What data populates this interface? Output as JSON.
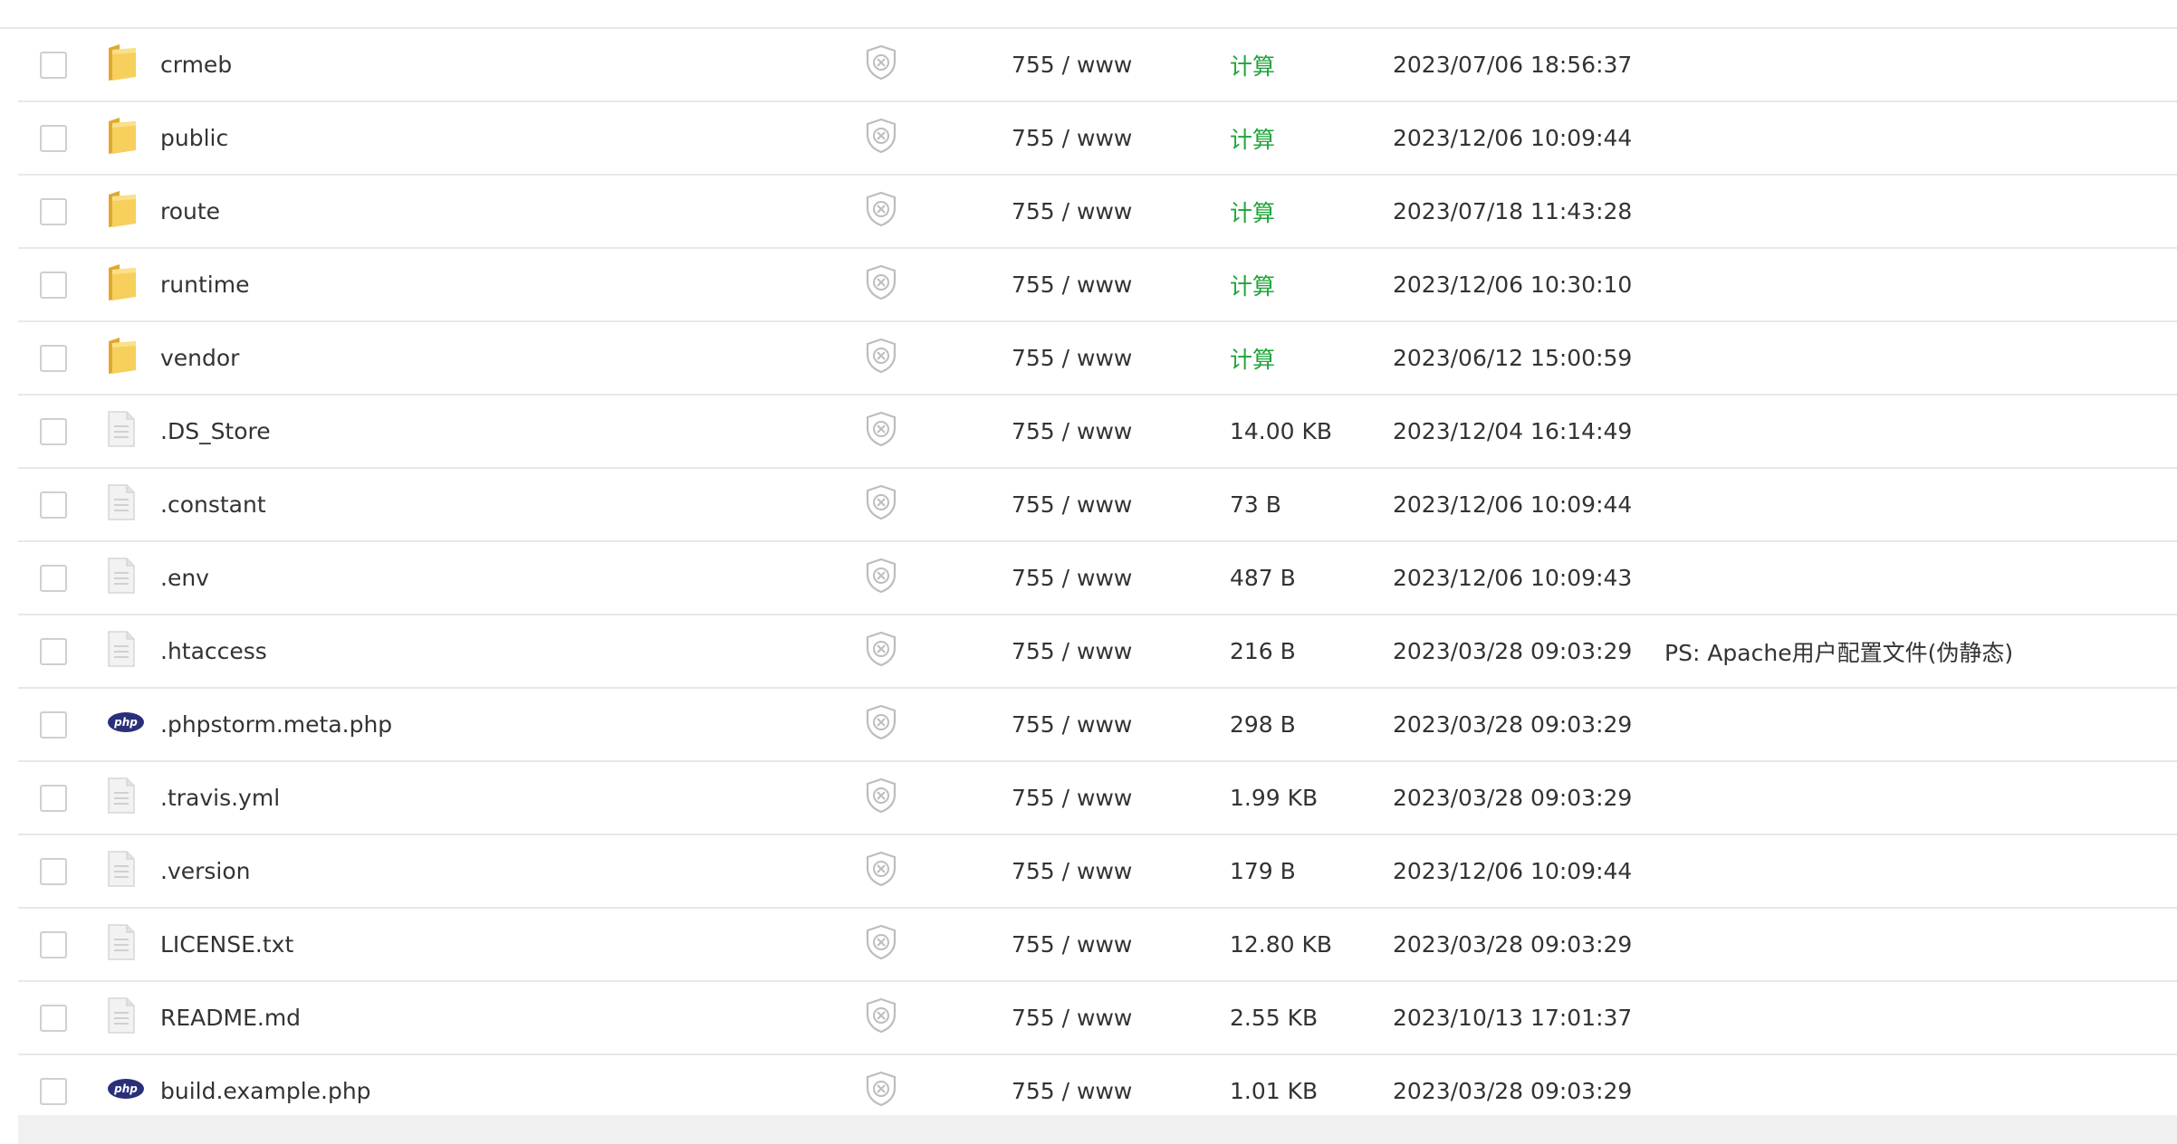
{
  "colors": {
    "accent_green": "#20a53a",
    "folder_yellow": "#f5c542",
    "php_navy": "#2a2f7a",
    "border": "#e8e8e8"
  },
  "files": [
    {
      "type": "folder",
      "name": "crmeb",
      "perm": "755 / www",
      "size": "计算",
      "mtime": "2023/07/06 18:56:37",
      "ps": ""
    },
    {
      "type": "folder",
      "name": "public",
      "perm": "755 / www",
      "size": "计算",
      "mtime": "2023/12/06 10:09:44",
      "ps": ""
    },
    {
      "type": "folder",
      "name": "route",
      "perm": "755 / www",
      "size": "计算",
      "mtime": "2023/07/18 11:43:28",
      "ps": ""
    },
    {
      "type": "folder",
      "name": "runtime",
      "perm": "755 / www",
      "size": "计算",
      "mtime": "2023/12/06 10:30:10",
      "ps": ""
    },
    {
      "type": "folder",
      "name": "vendor",
      "perm": "755 / www",
      "size": "计算",
      "mtime": "2023/06/12 15:00:59",
      "ps": ""
    },
    {
      "type": "file",
      "name": ".DS_Store",
      "perm": "755 / www",
      "size": "14.00 KB",
      "mtime": "2023/12/04 16:14:49",
      "ps": ""
    },
    {
      "type": "file",
      "name": ".constant",
      "perm": "755 / www",
      "size": "73 B",
      "mtime": "2023/12/06 10:09:44",
      "ps": ""
    },
    {
      "type": "file",
      "name": ".env",
      "perm": "755 / www",
      "size": "487 B",
      "mtime": "2023/12/06 10:09:43",
      "ps": ""
    },
    {
      "type": "file",
      "name": ".htaccess",
      "perm": "755 / www",
      "size": "216 B",
      "mtime": "2023/03/28 09:03:29",
      "ps": "PS: Apache用户配置文件(伪静态)"
    },
    {
      "type": "php",
      "name": ".phpstorm.meta.php",
      "perm": "755 / www",
      "size": "298 B",
      "mtime": "2023/03/28 09:03:29",
      "ps": ""
    },
    {
      "type": "file",
      "name": ".travis.yml",
      "perm": "755 / www",
      "size": "1.99 KB",
      "mtime": "2023/03/28 09:03:29",
      "ps": ""
    },
    {
      "type": "file",
      "name": ".version",
      "perm": "755 / www",
      "size": "179 B",
      "mtime": "2023/12/06 10:09:44",
      "ps": ""
    },
    {
      "type": "file",
      "name": "LICENSE.txt",
      "perm": "755 / www",
      "size": "12.80 KB",
      "mtime": "2023/03/28 09:03:29",
      "ps": ""
    },
    {
      "type": "file",
      "name": "README.md",
      "perm": "755 / www",
      "size": "2.55 KB",
      "mtime": "2023/10/13 17:01:37",
      "ps": ""
    },
    {
      "type": "php",
      "name": "build.example.php",
      "perm": "755 / www",
      "size": "1.01 KB",
      "mtime": "2023/03/28 09:03:29",
      "ps": ""
    }
  ],
  "php_icon_text": "php"
}
